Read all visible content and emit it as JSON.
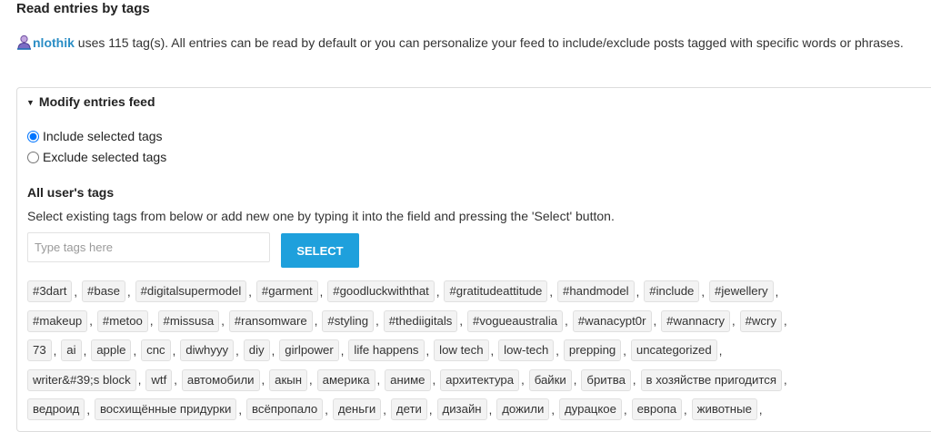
{
  "page": {
    "heading": "Read entries by tags",
    "username": "nlothik",
    "intro_rest": " uses 115 tag(s). All entries can be read by default or you can personalize your feed to include/exclude posts tagged with specific words or phrases."
  },
  "panel": {
    "title": "Modify entries feed",
    "radio_include": "Include selected tags",
    "radio_exclude": "Exclude selected tags",
    "selected_option": "include"
  },
  "tags_section": {
    "title": "All user's tags",
    "help": "Select existing tags from below or add new one by typing it into the field and pressing the 'Select' button.",
    "input_placeholder": "Type tags here",
    "input_value": "",
    "select_label": "SELECT"
  },
  "tag_rows": [
    [
      "#3dart",
      "#base",
      "#digitalsupermodel",
      "#garment",
      "#goodluckwiththat",
      "#gratitudeattitude",
      "#handmodel",
      "#include",
      "#jewellery"
    ],
    [
      "#makeup",
      "#metoo",
      "#missusa",
      "#ransomware",
      "#styling",
      "#thediigitals",
      "#vogueaustralia",
      "#wanacypt0r",
      "#wannacry",
      "#wcry"
    ],
    [
      "73",
      "ai",
      "apple",
      "cnc",
      "diwhyyy",
      "diy",
      "girlpower",
      "life happens",
      "low tech",
      "low-tech",
      "prepping",
      "uncategorized"
    ],
    [
      "writer&#39;s block",
      "wtf",
      "автомобили",
      "акын",
      "америка",
      "аниме",
      "архитектура",
      "байки",
      "бритва",
      "в хозяйстве пригодится"
    ],
    [
      "ведроид",
      "восхищённые придурки",
      "всёпропало",
      "деньги",
      "дети",
      "дизайн",
      "дожили",
      "дурацкое",
      "европа",
      "животные"
    ]
  ],
  "colors": {
    "accent": "#1ea0dc",
    "link": "#2a8dc5",
    "tag_bg": "#f3f3f3"
  },
  "icons": {
    "user": "user-icon",
    "caret": "caret-down-icon"
  }
}
